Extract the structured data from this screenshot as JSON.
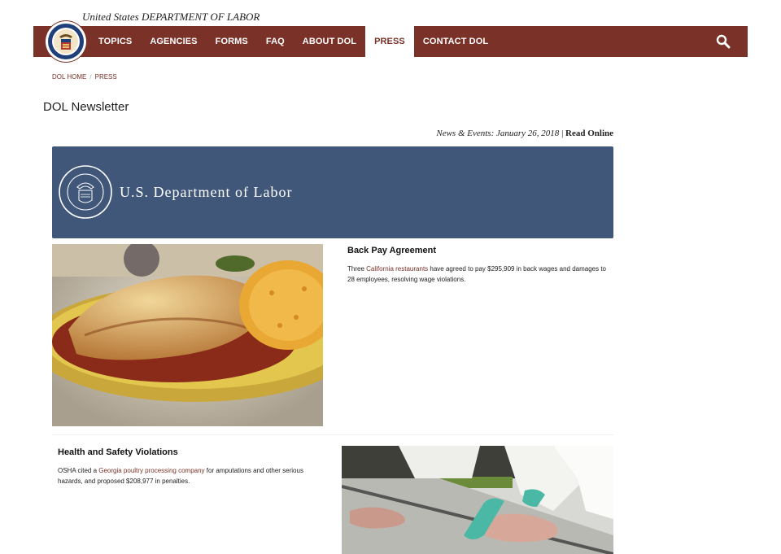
{
  "header": {
    "agency_prefix": "United States",
    "agency_name": "DEPARTMENT OF LABOR"
  },
  "nav": {
    "items": [
      {
        "label": "TOPICS",
        "active": false
      },
      {
        "label": "AGENCIES",
        "active": false
      },
      {
        "label": "FORMS",
        "active": false
      },
      {
        "label": "FAQ",
        "active": false
      },
      {
        "label": "ABOUT DOL",
        "active": false
      },
      {
        "label": "PRESS",
        "active": true
      },
      {
        "label": "CONTACT DOL",
        "active": false
      }
    ],
    "search_icon": "search-icon"
  },
  "breadcrumb": {
    "home": "DOL HOME",
    "separator": "/",
    "current": "PRESS"
  },
  "page": {
    "title": "DOL Newsletter"
  },
  "newsletter": {
    "date_line": "News & Events: January 26, 2018",
    "divider": "|",
    "read_online": "Read Online",
    "banner_title": "U.S. Department of Labor",
    "stories": [
      {
        "title": "Back Pay Agreement",
        "body_pre": "Three ",
        "link_text": "California restaurants",
        "body_post": " have agreed to pay $295,909 in back wages and damages to 28 employees, resolving wage violations."
      },
      {
        "title": "Health and Safety Violations",
        "body_pre": "OSHA cited a ",
        "link_text": "Georgia poultry processing company",
        "body_post": " for amputations and other serious hazards, and proposed $208,977 in penalties."
      }
    ]
  },
  "colors": {
    "nav_bg": "#7a3128",
    "banner_bg": "#40577a",
    "link": "#7a3128"
  }
}
